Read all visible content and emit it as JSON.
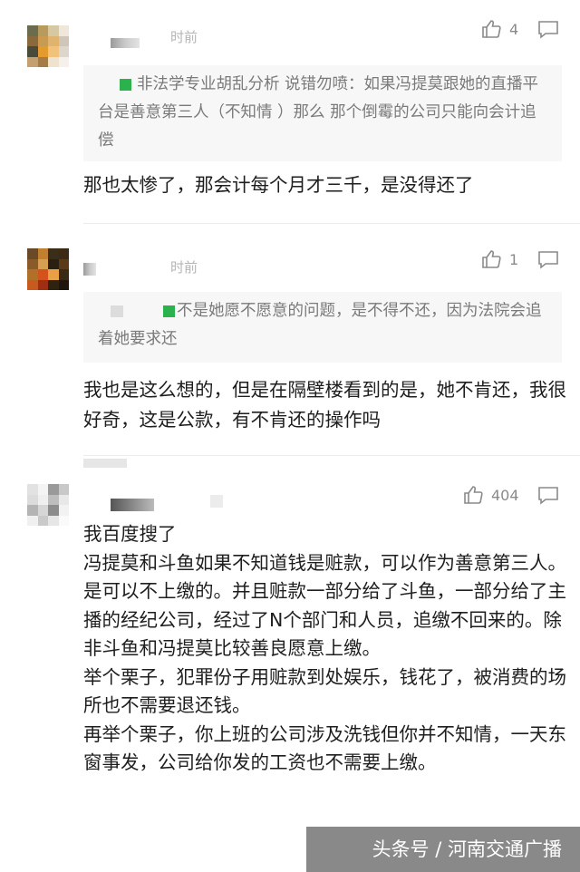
{
  "comments": [
    {
      "time": "时前",
      "likes": "4",
      "quote": "非法学专业胡乱分析 说错勿喷：如果冯提莫跟她的直播平台是善意第三人（不知情 ）那么 那个倒霉的公司只能向会计追偿",
      "text": "那也太惨了，那会计每个月才三千，是没得还了"
    },
    {
      "time": "时前",
      "likes": "1",
      "quote": "不是她愿不愿意的问题，是不得不还，因为法院会追着她要求还",
      "text": "我也是这么想的，但是在隔壁楼看到的是，她不肯还，我很好奇，这是公款，有不肯还的操作吗"
    },
    {
      "time": "",
      "likes": "404",
      "text": "我百度搜了\n冯提莫和斗鱼如果不知道钱是赃款，可以作为善意第三人。是可以不上缴的。并且赃款一部分给了斗鱼，一部分给了主播的经纪公司，经过了N个部门和人员，追缴不回来的。除非斗鱼和冯提莫比较善良愿意上缴。\n举个栗子，犯罪份子用赃款到处娱乐，钱花了，被消费的场所也不需要退还钱。\n再举个栗子，你上班的公司涉及洗钱但你并不知情，一天东窗事发，公司给你发的工资也不需要上缴。"
    }
  ],
  "watermark": "头条号 / 河南交通广播",
  "icons": [
    "thumbs-up-icon",
    "reply-icon"
  ],
  "colors": {
    "accent_green": "#2bb24c",
    "quote_bg": "#f7f7f7"
  }
}
